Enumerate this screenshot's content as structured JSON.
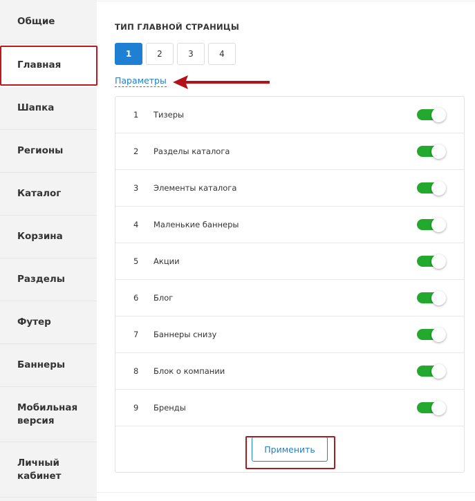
{
  "sidebar": {
    "items": [
      {
        "label": "Общие"
      },
      {
        "label": "Главная"
      },
      {
        "label": "Шапка"
      },
      {
        "label": "Регионы"
      },
      {
        "label": "Каталог"
      },
      {
        "label": "Корзина"
      },
      {
        "label": "Разделы"
      },
      {
        "label": "Футер"
      },
      {
        "label": "Баннеры"
      },
      {
        "label": "Мобильная версия"
      },
      {
        "label": "Личный кабинет"
      }
    ],
    "active_index": 1
  },
  "main": {
    "section_title": "ТИП ГЛАВНОЙ СТРАНИЦЫ",
    "type_tabs": [
      "1",
      "2",
      "3",
      "4"
    ],
    "active_type": "1",
    "params_link": "Параметры",
    "blocks": [
      {
        "num": "1",
        "label": "Тизеры",
        "enabled": true
      },
      {
        "num": "2",
        "label": "Разделы каталога",
        "enabled": true
      },
      {
        "num": "3",
        "label": "Элементы каталога",
        "enabled": true
      },
      {
        "num": "4",
        "label": "Маленькие баннеры",
        "enabled": true
      },
      {
        "num": "5",
        "label": "Акции",
        "enabled": true
      },
      {
        "num": "6",
        "label": "Блог",
        "enabled": true
      },
      {
        "num": "7",
        "label": "Баннеры снизу",
        "enabled": true
      },
      {
        "num": "8",
        "label": "Блок о компании",
        "enabled": true
      },
      {
        "num": "9",
        "label": "Бренды",
        "enabled": true
      }
    ],
    "apply_label": "Применить"
  },
  "colors": {
    "accent": "#1e7fd3",
    "toggle_on": "#22a92e",
    "highlight": "#c0161f",
    "sidebar_bg": "#f3f3f3"
  }
}
